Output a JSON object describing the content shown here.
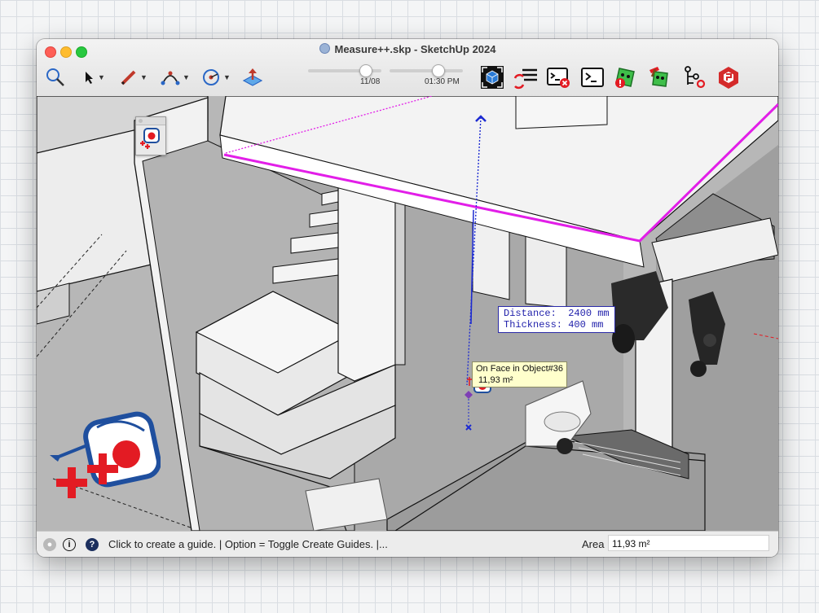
{
  "window": {
    "title": "Measure++.skp - SketchUp 2024"
  },
  "toolbar": {
    "icons": [
      "search-icon",
      "select-arrow-icon",
      "pencil-icon",
      "arc-icon",
      "circle-icon",
      "push-pull-icon"
    ],
    "shadow_date": "11/08",
    "shadow_time": "01:30 PM",
    "extension_icons": [
      "viewcube-icon",
      "refresh-list-icon",
      "console-error-icon",
      "console-icon",
      "warning-bug-icon",
      "ruby-tool-icon",
      "hierarchy-icon",
      "extension-cube-icon"
    ]
  },
  "viewport": {
    "measure_tooltip": {
      "distance": "Distance:  2400 mm",
      "thickness": "Thickness: 400 mm"
    },
    "inference_tooltip": {
      "line1": "On Face in Object#36",
      "line2": "11,93 m²"
    },
    "highlight_color": "#e21ee8",
    "guide_color": "#1d2bd1"
  },
  "statusbar": {
    "message": "Click to create a guide. | Option = Toggle Create Guides. |...",
    "measure_label": "Area",
    "measure_value": "11,93 m²"
  },
  "colors": {
    "accent_red": "#e31b23",
    "accent_blue": "#1f4f9e"
  }
}
